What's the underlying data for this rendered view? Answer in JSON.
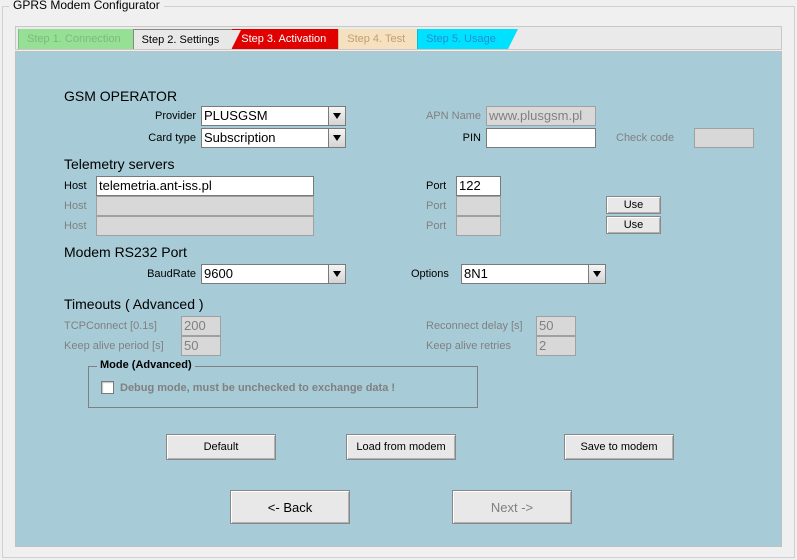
{
  "window": {
    "title": "GPRS Modem Configurator"
  },
  "tabs": [
    {
      "label": "Step 1. Connection"
    },
    {
      "label": "Step 2. Settings"
    },
    {
      "label": "Step 3. Activation"
    },
    {
      "label": "Step 4. Test"
    },
    {
      "label": "Step 5. Usage"
    }
  ],
  "gsm": {
    "title": "GSM OPERATOR",
    "provider_label": "Provider",
    "provider_value": "PLUSGSM",
    "cardtype_label": "Card type",
    "cardtype_value": "Subscription",
    "apn_label": "APN Name",
    "apn_value": "www.plusgsm.pl",
    "pin_label": "PIN",
    "pin_value": "",
    "checkcode_label": "Check code",
    "checkcode_value": ""
  },
  "telemetry": {
    "title": "Telemetry servers",
    "host_label": "Host",
    "host1": "telemetria.ant-iss.pl",
    "host2": "",
    "host3": "",
    "port_label": "Port",
    "port1": "122",
    "port2": "",
    "port3": "",
    "use_label": "Use"
  },
  "rs232": {
    "title": "Modem RS232 Port",
    "baud_label": "BaudRate",
    "baud_value": "9600",
    "options_label": "Options",
    "options_value": "8N1"
  },
  "timeouts": {
    "title": "Timeouts ( Advanced )",
    "tcp_label": "TCPConnect [0.1s]",
    "tcp_value": "200",
    "keepalive_label": "Keep alive period [s]",
    "keepalive_value": "50",
    "reconnect_label": "Reconnect delay [s]",
    "reconnect_value": "50",
    "retries_label": "Keep alive retries",
    "retries_value": "2"
  },
  "mode": {
    "legend": "Mode (Advanced)",
    "debug_label": "Debug mode, must be unchecked to exchange data !"
  },
  "buttons": {
    "default": "Default",
    "load": "Load from modem",
    "save": "Save to modem",
    "back": "<- Back",
    "next": "Next ->"
  }
}
